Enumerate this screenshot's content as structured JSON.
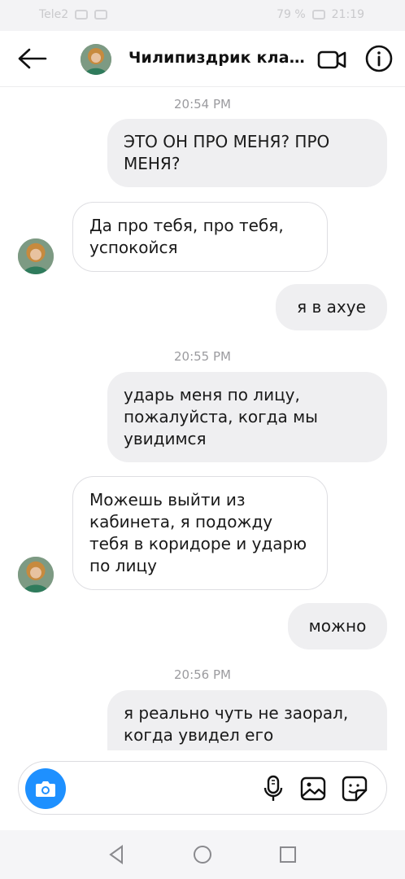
{
  "status_bar": {
    "left_text": "Tele2",
    "battery": "79 %",
    "time": "21:19"
  },
  "header": {
    "title": "Чилипиздрик класс…",
    "back_icon": "arrow-left-icon",
    "video_icon": "video-camera-icon",
    "info_icon": "info-icon"
  },
  "messages": [
    {
      "type": "time",
      "text": "20:54 PM"
    },
    {
      "type": "out",
      "text": "ЭТО ОН ПРО МЕНЯ? ПРО МЕНЯ?"
    },
    {
      "type": "in",
      "text": "Да про тебя, про тебя, успокойся"
    },
    {
      "type": "out",
      "text": "я в ахуе"
    },
    {
      "type": "time",
      "text": "20:55 PM"
    },
    {
      "type": "out",
      "text": "ударь меня по лицу, пожалуйста, когда мы увидимся"
    },
    {
      "type": "in",
      "text": "Можешь выйти из кабинета, я подожду тебя в коридоре и ударю по лицу"
    },
    {
      "type": "out",
      "text": "можно"
    },
    {
      "type": "time",
      "text": "20:56 PM"
    },
    {
      "type": "out",
      "text": "я реально чуть не заорал, когда увидел его"
    }
  ],
  "composer": {
    "camera_icon": "camera-icon",
    "mic_icon": "microphone-icon",
    "gallery_icon": "gallery-icon",
    "sticker_icon": "sticker-icon"
  },
  "nav": {
    "back_icon": "nav-back-icon",
    "home_icon": "nav-home-icon",
    "recents_icon": "nav-recents-icon"
  },
  "colors": {
    "accent": "#1e90ff",
    "outgoing_bubble": "#efeff1",
    "incoming_border": "#dedee2",
    "timestamp": "#9b9b9f"
  }
}
